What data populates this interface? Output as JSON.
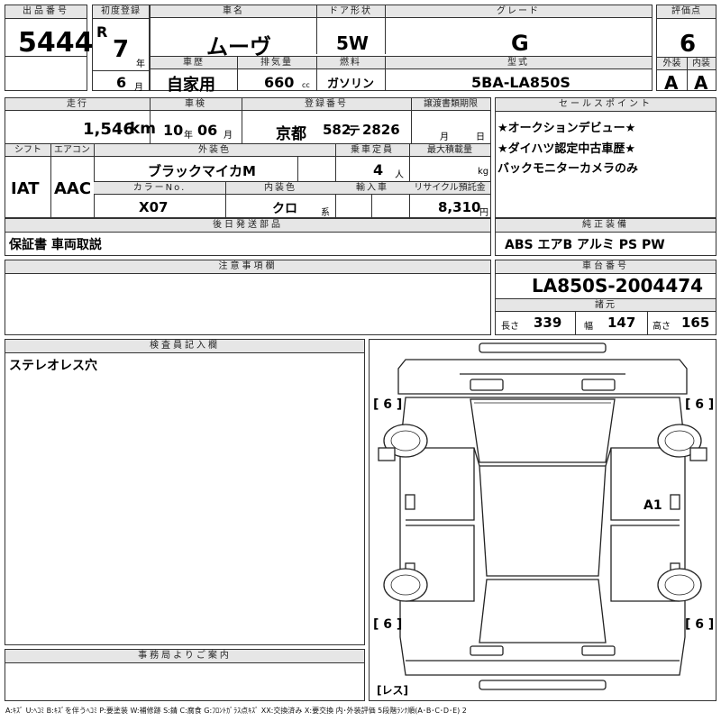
{
  "lot": {
    "label": "出品番号",
    "value": "5444"
  },
  "first_reg": {
    "label": "初度登録",
    "era": "R",
    "year": "7",
    "year_unit": "年",
    "month": "6",
    "month_unit": "月"
  },
  "car_name": {
    "label": "車名",
    "value": "ムーヴ"
  },
  "door": {
    "label": "ドア形状",
    "value": "5W"
  },
  "grade": {
    "label": "グレード",
    "value": "G"
  },
  "score": {
    "label": "評価点",
    "value": "6"
  },
  "history": {
    "label": "車歴",
    "value": "自家用"
  },
  "displacement": {
    "label": "排気量",
    "value": "660",
    "unit": "cc"
  },
  "fuel": {
    "label": "燃料",
    "value": "ガソリン"
  },
  "model": {
    "label": "型式",
    "value": "5BA-LA850S"
  },
  "exterior_grade": {
    "label": "外装",
    "value": "A"
  },
  "interior_grade": {
    "label": "内装",
    "value": "A"
  },
  "mileage": {
    "label": "走行",
    "value": "1,546",
    "unit": "km"
  },
  "inspection": {
    "label": "車検",
    "year": "10",
    "year_unit": "年",
    "month": "06",
    "month_unit": "月"
  },
  "plate": {
    "label": "登録番号",
    "area": "京都",
    "class": "582",
    "kana": "テ",
    "number": "2826"
  },
  "transfer_deadline": {
    "label": "譲渡書類期限",
    "month_unit": "月",
    "day_unit": "日"
  },
  "shift": {
    "label": "シフト",
    "value": "IAT"
  },
  "aircon": {
    "label": "エアコン",
    "value": "AAC"
  },
  "exterior_color": {
    "label": "外装色",
    "value": "ブラックマイカM"
  },
  "capacity": {
    "label": "乗車定員",
    "value": "4",
    "unit": "人"
  },
  "max_load": {
    "label": "最大積載量",
    "unit": "kg"
  },
  "color_no": {
    "label": "カラーNo.",
    "value": "X07"
  },
  "interior_color": {
    "label": "内装色",
    "value": "クロ",
    "unit": "系"
  },
  "import": {
    "label": "輸入車"
  },
  "recycle": {
    "label": "リサイクル預託金",
    "value": "8,310",
    "unit": "円"
  },
  "sales_points": {
    "label": "セールスポイント",
    "lines": [
      "★オークションデビュー★",
      "★ダイハツ認定中古車歴★",
      "バックモニターカメラのみ"
    ]
  },
  "later_parts": {
    "label": "後日発送部品",
    "value": "保証書 車両取説"
  },
  "equipment": {
    "label": "純正装備",
    "value": "ABS エアB アルミ PS PW"
  },
  "notes": {
    "label": "注意事項欄"
  },
  "chassis": {
    "label": "車台番号",
    "value": "LA850S-2004474"
  },
  "specs": {
    "label": "諸元",
    "length_label": "長さ",
    "length": "339",
    "width_label": "幅",
    "width": "147",
    "height_label": "高さ",
    "height": "165"
  },
  "inspector": {
    "label": "検査員記入欄",
    "value": "ステレオレス穴"
  },
  "office": {
    "label": "事務局よりご案内"
  },
  "diagram": {
    "tire_fl": "[ 6 ]",
    "tire_fr": "[ 6 ]",
    "tire_rl": "[ 6 ]",
    "tire_rr": "[ 6 ]",
    "damage_mark": "A1",
    "spare": "[レス]"
  },
  "legend": "A:ｷｽﾞ U:ﾍｺﾐ B:ｷｽﾞを伴うﾍｺﾐ P:要塗装 W:補修跡 S:錆 C:腐食 G:ﾌﾛﾝﾄｶﾞﾗｽ点ｷｽﾞ XX:交換済み X:要交換 内･外装評価 5段階ﾗﾝｸ順(A･B･C･D･E) 2"
}
